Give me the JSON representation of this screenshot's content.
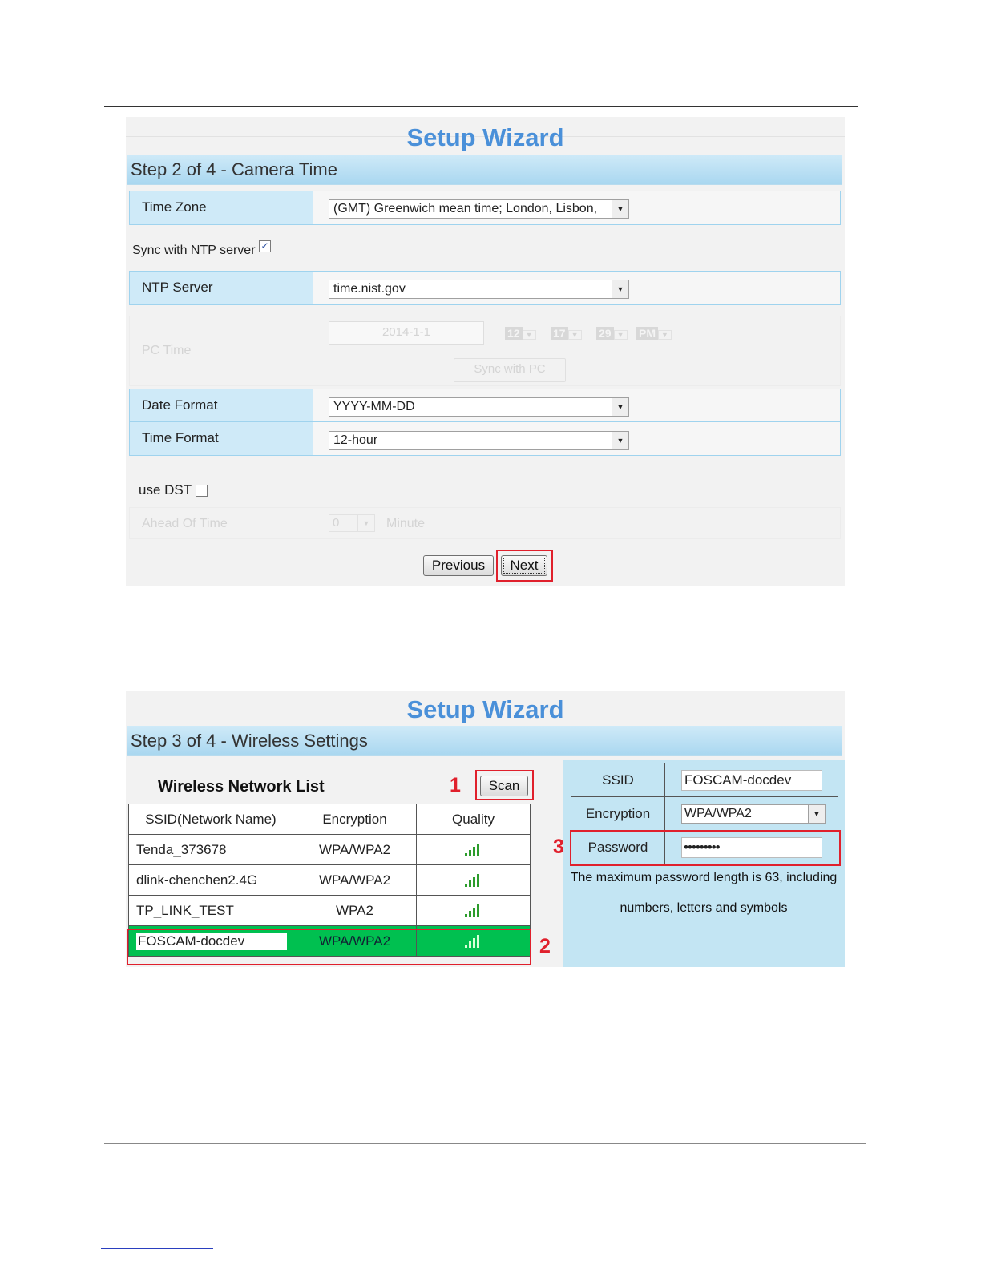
{
  "wizard1": {
    "title": "Setup Wizard",
    "step": "Step 2 of 4 - Camera Time",
    "time_zone_label": "Time Zone",
    "time_zone_value": "(GMT) Greenwich mean time; London, Lisbon,",
    "sync_ntp_label": "Sync with NTP server",
    "sync_ntp_checked": true,
    "ntp_server_label": "NTP Server",
    "ntp_server_value": "time.nist.gov",
    "pc_time_label": "PC Time",
    "pc_date_value": "2014-1-1",
    "pc_hour": "12",
    "pc_minute": "17",
    "pc_second": "29",
    "pc_ampm": "PM",
    "sync_pc_label": "Sync with PC",
    "date_format_label": "Date Format",
    "date_format_value": "YYYY-MM-DD",
    "time_format_label": "Time Format",
    "time_format_value": "12-hour",
    "use_dst_label": "use DST",
    "use_dst_checked": false,
    "ahead_label": "Ahead Of Time",
    "ahead_value": "0",
    "ahead_unit": "Minute",
    "previous_label": "Previous",
    "next_label": "Next"
  },
  "wizard2": {
    "title": "Setup Wizard",
    "step": "Step 3 of 4 - Wireless Settings",
    "list_title": "Wireless Network List",
    "scan_label": "Scan",
    "columns": [
      "SSID(Network Name)",
      "Encryption",
      "Quality"
    ],
    "networks": [
      {
        "ssid": "Tenda_373678",
        "encryption": "WPA/WPA2"
      },
      {
        "ssid": "dlink-chenchen2.4G",
        "encryption": "WPA/WPA2"
      },
      {
        "ssid": "TP_LINK_TEST",
        "encryption": "WPA2"
      },
      {
        "ssid": "FOSCAM-docdev",
        "encryption": "WPA/WPA2",
        "selected": true
      }
    ],
    "ssid_label": "SSID",
    "ssid_value": "FOSCAM-docdev",
    "encryption_label": "Encryption",
    "encryption_value": "WPA/WPA2",
    "password_label": "Password",
    "password_value": "•••••••••",
    "note_line1": "The maximum password length is 63, including",
    "note_line2": "numbers, letters and symbols"
  },
  "annotations": [
    "1",
    "2",
    "3"
  ],
  "colors": {
    "title_blue": "#4a90d9",
    "highlight_red": "#e0202c",
    "selected_row_green": "#00c050",
    "label_bg": "#cfeaf8"
  }
}
